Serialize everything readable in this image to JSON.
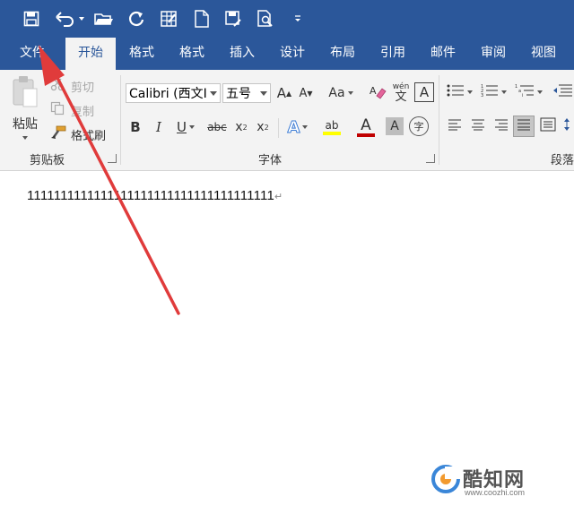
{
  "quick_access": {
    "icons": [
      "save-icon",
      "undo-icon",
      "open-folder-icon",
      "redo-icon",
      "table-icon",
      "new-document-icon",
      "save-as-icon",
      "print-preview-icon",
      "customize-toolbar-icon"
    ]
  },
  "tabs": [
    {
      "label": "文件"
    },
    {
      "label": "开始"
    },
    {
      "label": "格式"
    },
    {
      "label": "格式"
    },
    {
      "label": "插入"
    },
    {
      "label": "设计"
    },
    {
      "label": "布局"
    },
    {
      "label": "引用"
    },
    {
      "label": "邮件"
    },
    {
      "label": "审阅"
    },
    {
      "label": "视图"
    }
  ],
  "clipboard": {
    "paste": "粘贴",
    "cut": "剪切",
    "copy": "复制",
    "format_painter": "格式刷",
    "group_label": "剪贴板"
  },
  "font": {
    "font_name": "Calibri (西文I",
    "font_size": "五号",
    "grow": "A",
    "shrink": "A",
    "change_case": "Aa",
    "phonetic_top": "wén",
    "phonetic_bottom": "文",
    "char_border": "A",
    "bold": "B",
    "italic": "I",
    "underline": "U",
    "strikethrough": "abc",
    "subscript": "x",
    "subscript_mark": "2",
    "superscript": "x",
    "superscript_mark": "2",
    "text_effects": "A",
    "highlight": "ab",
    "font_color": "A",
    "char_shading": "A",
    "enclose": "字",
    "group_label": "字体"
  },
  "paragraph": {
    "group_label": "段落"
  },
  "document": {
    "text": "1111111111111111111111111111111111111",
    "paragraph_mark": "↵"
  },
  "watermark": {
    "brand": "酷知网",
    "url": "www.coozhi.com"
  },
  "colors": {
    "ribbon_blue": "#2b579a",
    "arrow_red": "#e03b3b",
    "highlight_yellow": "#ffff00",
    "font_color_red": "#c00000"
  }
}
